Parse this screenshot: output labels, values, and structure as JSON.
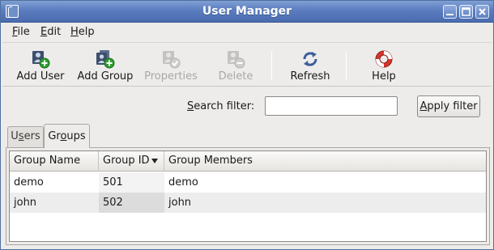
{
  "window": {
    "title": "User Manager"
  },
  "menubar": {
    "items": [
      {
        "label": "File",
        "mnemonic": "F",
        "rest": "ile"
      },
      {
        "label": "Edit",
        "mnemonic": "E",
        "rest": "dit"
      },
      {
        "label": "Help",
        "mnemonic": "H",
        "rest": "elp"
      }
    ]
  },
  "toolbar": {
    "add_user": {
      "label": "Add User",
      "icon": "add-user-icon",
      "enabled": true
    },
    "add_group": {
      "label": "Add Group",
      "icon": "add-group-icon",
      "enabled": true
    },
    "properties": {
      "label": "Properties",
      "icon": "properties-icon",
      "enabled": false
    },
    "delete": {
      "label": "Delete",
      "icon": "delete-icon",
      "enabled": false
    },
    "refresh": {
      "label": "Refresh",
      "icon": "refresh-icon",
      "enabled": true
    },
    "help": {
      "label": "Help",
      "icon": "lifebuoy-help-icon",
      "enabled": true
    }
  },
  "search": {
    "label_mnemonic": "S",
    "label_rest": "earch filter:",
    "value": "",
    "apply_label": "Apply filter",
    "apply_mnemonic": "A",
    "apply_rest": "pply filter"
  },
  "tabs": [
    {
      "label": "Users",
      "pre": "U",
      "mnemonic": "s",
      "post": "ers",
      "active": false
    },
    {
      "label": "Groups",
      "pre": "Gr",
      "mnemonic": "o",
      "post": "ups",
      "active": true
    }
  ],
  "groups_table": {
    "columns": [
      "Group Name",
      "Group ID",
      "Group Members"
    ],
    "sorted_column": "Group ID",
    "sort_direction": "descending",
    "rows": [
      {
        "name": "demo",
        "id": "501",
        "members": "demo"
      },
      {
        "name": "john",
        "id": "502",
        "members": "john"
      }
    ]
  },
  "colors": {
    "titlebar": "#5b7dbf",
    "window_bg": "#edeceb",
    "alt_row": "#ededed",
    "disabled_text": "#a9a8a6"
  }
}
